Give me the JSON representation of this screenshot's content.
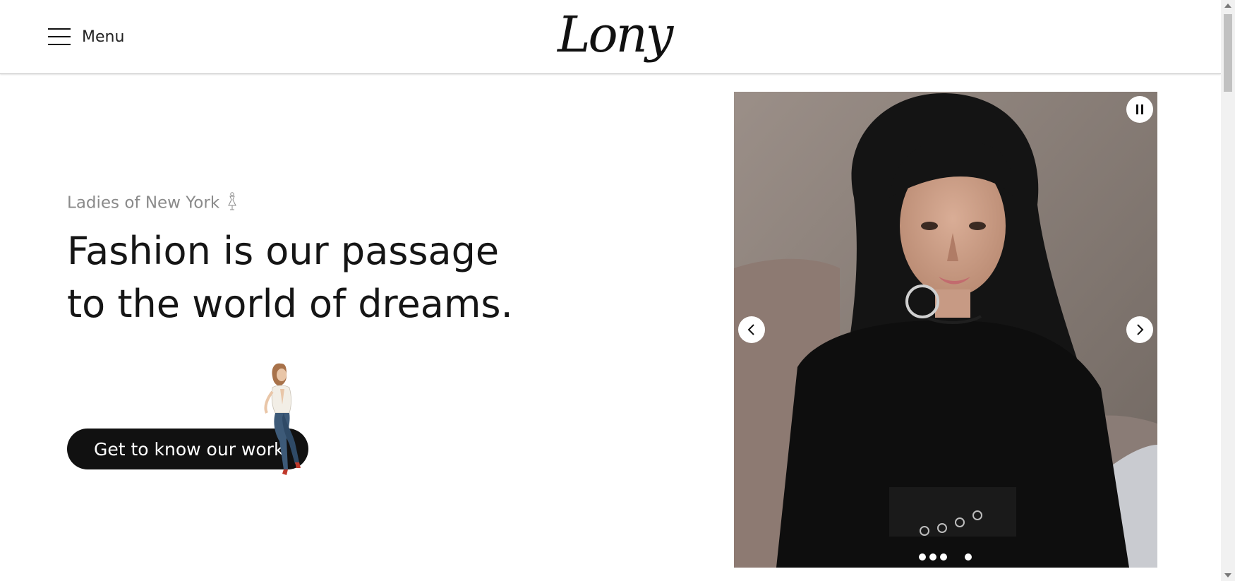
{
  "header": {
    "menu_label": "Menu",
    "logo_text": "Lony"
  },
  "hero": {
    "kicker": "Ladies of New York",
    "headline_line1": "Fashion is our passage",
    "headline_line2": "to the world of dreams.",
    "cta_label": "Get to know our work"
  },
  "carousel": {
    "pause_icon": "pause-icon",
    "prev_icon": "chevron-left-icon",
    "next_icon": "chevron-right-icon",
    "slide_count": 4,
    "active_slide": 1
  },
  "colors": {
    "text": "#151515",
    "muted": "#8a8a8a",
    "button": "#111111",
    "background": "#ffffff"
  }
}
